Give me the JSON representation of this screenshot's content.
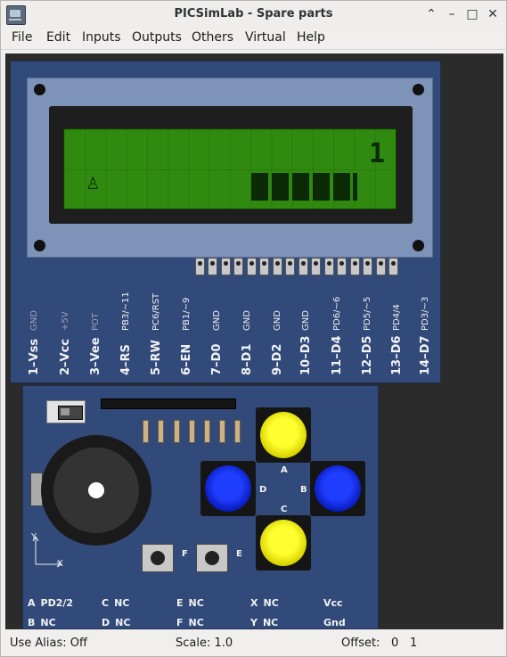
{
  "window": {
    "title": "PICSimLab - Spare parts"
  },
  "menu": [
    "File",
    "Edit",
    "Inputs",
    "Outputs",
    "Others",
    "Virtual",
    "Help"
  ],
  "lcd": {
    "digit": "1",
    "pins": [
      {
        "name": "1–Vss",
        "signal": "GND",
        "dim": true
      },
      {
        "name": "2–Vcc",
        "signal": "+5V",
        "dim": true
      },
      {
        "name": "3–Vee",
        "signal": "POT",
        "dim": true
      },
      {
        "name": "4–RS",
        "signal": "PB3/~11",
        "dim": false
      },
      {
        "name": "5–RW",
        "signal": "PC6/RST",
        "dim": false
      },
      {
        "name": "6–EN",
        "signal": "PB1/~9",
        "dim": false
      },
      {
        "name": "7–D0",
        "signal": "GND",
        "dim": false
      },
      {
        "name": "8–D1",
        "signal": "GND",
        "dim": false
      },
      {
        "name": "9–D2",
        "signal": "GND",
        "dim": false
      },
      {
        "name": "10–D3",
        "signal": "GND",
        "dim": false
      },
      {
        "name": "11–D4",
        "signal": "PD6/~6",
        "dim": false
      },
      {
        "name": "12–D5",
        "signal": "PD5/~5",
        "dim": false
      },
      {
        "name": "13–D6",
        "signal": "PD4/4",
        "dim": false
      },
      {
        "name": "14–D7",
        "signal": "PD3/~3",
        "dim": false
      }
    ]
  },
  "io": {
    "buttons": {
      "A": "A",
      "B": "B",
      "C": "C",
      "D": "D",
      "E": "E",
      "F": "F"
    },
    "axis": {
      "x": "X",
      "y": "Y"
    },
    "pinmap": [
      {
        "key": "A",
        "val": "PD2/2"
      },
      {
        "key": "B",
        "val": "NC"
      },
      {
        "key": "C",
        "val": "NC"
      },
      {
        "key": "D",
        "val": "NC"
      },
      {
        "key": "E",
        "val": "NC"
      },
      {
        "key": "F",
        "val": "NC"
      },
      {
        "key": "X",
        "val": "NC"
      },
      {
        "key": "Y",
        "val": "NC"
      },
      {
        "key": "Vcc",
        "val": ""
      },
      {
        "key": "Gnd",
        "val": ""
      }
    ]
  },
  "status": {
    "alias": "Use Alias: Off",
    "scale": "Scale: 1.0",
    "offset_label": "Offset:",
    "offset_x": "0",
    "offset_y": "1"
  }
}
